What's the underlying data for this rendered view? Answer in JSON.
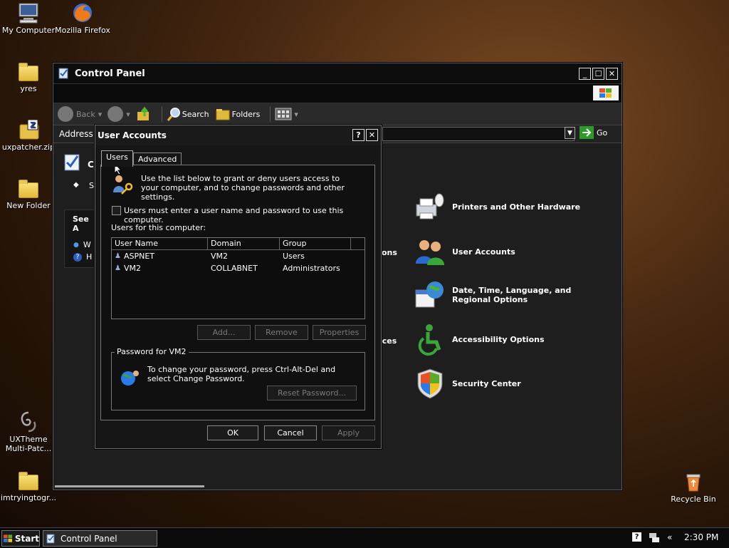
{
  "desktop": {
    "icons": [
      {
        "label": "My Computer"
      },
      {
        "label": "Mozilla Firefox"
      },
      {
        "label": "yres"
      },
      {
        "label": "uxpatcher.zip"
      },
      {
        "label": "New Folder"
      },
      {
        "label": "UXTheme Multi-Patc..."
      },
      {
        "label": "imtryingtogr..."
      },
      {
        "label": "Recycle Bin"
      }
    ]
  },
  "control_panel": {
    "title": "Control Panel",
    "toolbar": {
      "back": "Back",
      "search": "Search",
      "folders": "Folders"
    },
    "address_label": "Address",
    "go_label": "Go",
    "left_partial": {
      "see_also": "See A",
      "item_c": "C",
      "item_s": "S",
      "item_w": "W",
      "item_h": "H"
    },
    "partial_labels": {
      "ons": "ons",
      "ices": "ices"
    },
    "categories": [
      {
        "label": "Printers and Other Hardware",
        "icon": "printer-icon"
      },
      {
        "label": "User Accounts",
        "icon": "users-icon"
      },
      {
        "label": "Date, Time, Language, and Regional Options",
        "icon": "calendar-globe-icon"
      },
      {
        "label": "Accessibility Options",
        "icon": "accessibility-icon"
      },
      {
        "label": "Security Center",
        "icon": "shield-icon"
      }
    ]
  },
  "dialog": {
    "title": "User Accounts",
    "help": "?",
    "close": "✕",
    "tabs": [
      "Users",
      "Advanced"
    ],
    "description": "Use the list below to grant or deny users access to your computer, and to change passwords and other settings.",
    "checkbox_label": "Users must enter a user name and password to use this computer.",
    "checkbox_checked": false,
    "list_label": "Users for this computer:",
    "columns": [
      "User Name",
      "Domain",
      "Group"
    ],
    "rows": [
      {
        "user": "ASPNET",
        "domain": "VM2",
        "group": "Users"
      },
      {
        "user": "VM2",
        "domain": "COLLABNET",
        "group": "Administrators"
      }
    ],
    "buttons": {
      "add": "Add...",
      "remove": "Remove",
      "properties": "Properties",
      "reset_password": "Reset Password...",
      "ok": "OK",
      "cancel": "Cancel",
      "apply": "Apply"
    },
    "password_group_title": "Password for VM2",
    "password_text": "To change your password, press Ctrl-Alt-Del and select Change Password."
  },
  "taskbar": {
    "start": "Start",
    "task": "Control Panel",
    "clock": "2:30 PM",
    "chevron": "«"
  }
}
